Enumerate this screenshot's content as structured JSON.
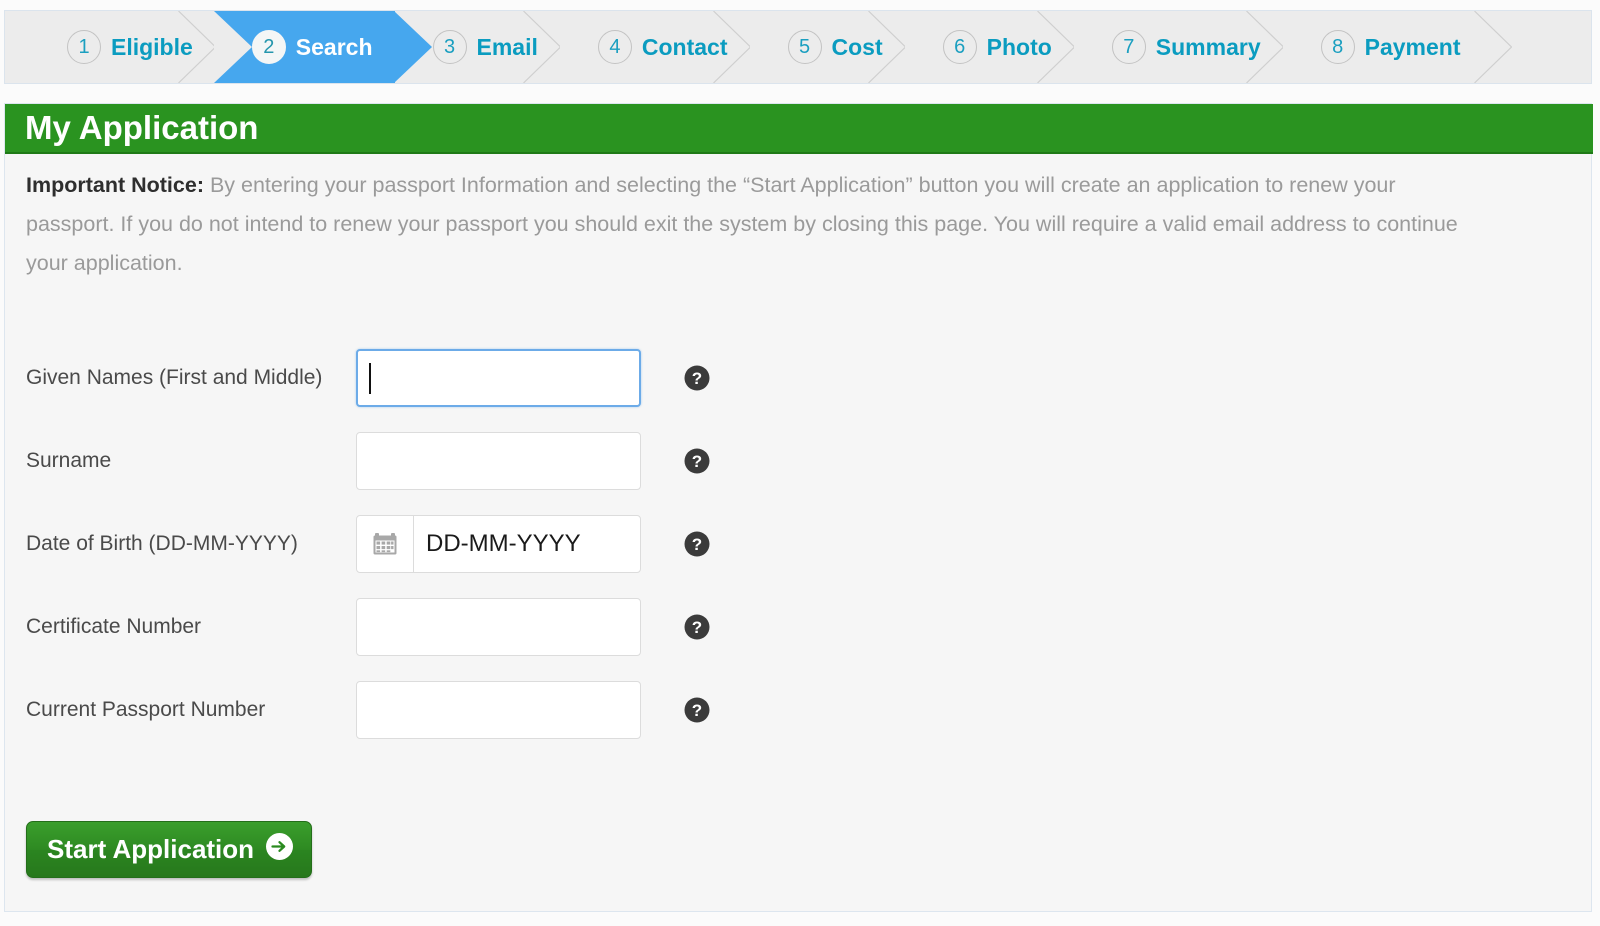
{
  "stepper": {
    "steps": [
      {
        "num": "1",
        "label": "Eligible",
        "active": false
      },
      {
        "num": "2",
        "label": "Search",
        "active": true
      },
      {
        "num": "3",
        "label": "Email",
        "active": false
      },
      {
        "num": "4",
        "label": "Contact",
        "active": false
      },
      {
        "num": "5",
        "label": "Cost",
        "active": false
      },
      {
        "num": "6",
        "label": "Photo",
        "active": false
      },
      {
        "num": "7",
        "label": "Summary",
        "active": false
      },
      {
        "num": "8",
        "label": "Payment",
        "active": false
      }
    ],
    "active_color": "#46a7ee",
    "inactive_bg": "#ececec",
    "label_color": "#0b9cc0"
  },
  "header": {
    "title": "My Application",
    "bg_color": "#2a9320"
  },
  "notice": {
    "strong": "Important Notice:",
    "text": " By entering your passport Information and selecting the “Start Application” button you will create an application to renew your passport. If you do not intend to renew your passport you should exit the system by closing this page. You will require a valid email address to continue your application."
  },
  "form": {
    "fields": [
      {
        "label": "Given Names (First and Middle)",
        "value": "",
        "placeholder": "",
        "focused": true,
        "has_calendar": false,
        "help": "?"
      },
      {
        "label": "Surname",
        "value": "",
        "placeholder": "",
        "focused": false,
        "has_calendar": false,
        "help": "?"
      },
      {
        "label": "Date of Birth (DD-MM-YYYY)",
        "value": "",
        "placeholder": "DD-MM-YYYY",
        "focused": false,
        "has_calendar": true,
        "help": "?"
      },
      {
        "label": "Certificate Number",
        "value": "",
        "placeholder": "",
        "focused": false,
        "has_calendar": false,
        "help": "?"
      },
      {
        "label": "Current Passport Number",
        "value": "",
        "placeholder": "",
        "focused": false,
        "has_calendar": false,
        "help": "?"
      }
    ]
  },
  "submit": {
    "label": "Start Application"
  }
}
